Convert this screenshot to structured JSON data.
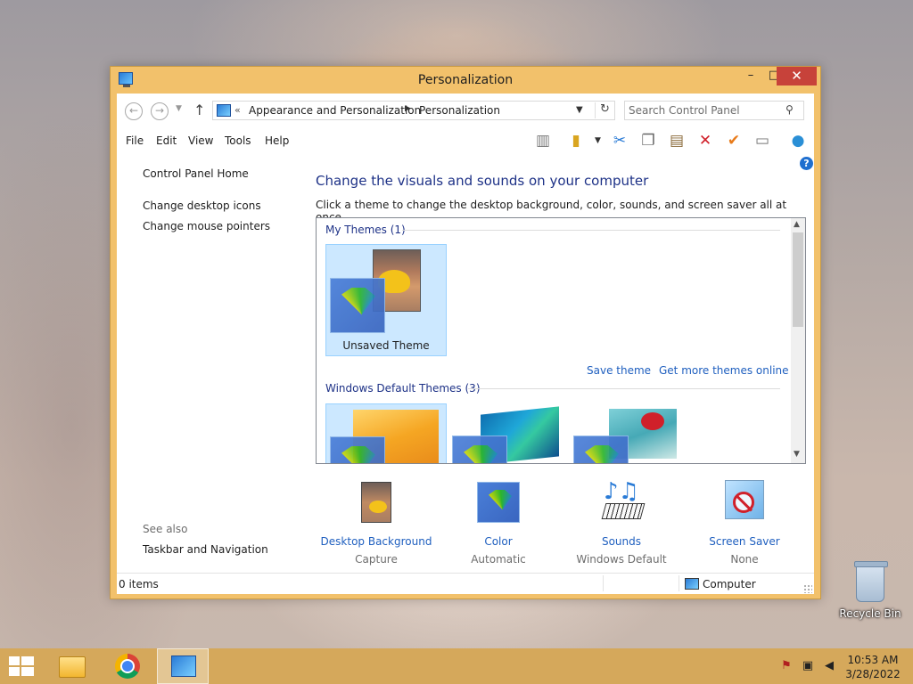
{
  "window": {
    "title": "Personalization",
    "controls": {
      "minimize": "–",
      "maximize": "□",
      "close": "✕"
    }
  },
  "address_bar": {
    "back_symbol": "←",
    "forward_symbol": "→",
    "up_symbol": "↑",
    "overflow": "«",
    "crumbs": [
      "Appearance and Personalization",
      "Personalization"
    ],
    "crumb_separator": "▶",
    "refresh_symbol": "↻"
  },
  "search": {
    "placeholder": "Search Control Panel"
  },
  "menu": [
    "File",
    "Edit",
    "View",
    "Tools",
    "Help"
  ],
  "toolbar_icons": [
    "layout-icon",
    "folder-check-icon",
    "cut-icon",
    "copy-icon",
    "paste-icon",
    "delete-icon",
    "properties-icon",
    "rename-icon",
    "globe-icon"
  ],
  "help": {
    "symbol": "?"
  },
  "left_pane": {
    "home": "Control Panel Home",
    "links": [
      "Change desktop icons",
      "Change mouse pointers"
    ],
    "see_also_label": "See also",
    "see_also_links": [
      "Taskbar and Navigation"
    ]
  },
  "main": {
    "heading": "Change the visuals and sounds on your computer",
    "subheading": "Click a theme to change the desktop background, color, sounds, and screen saver all at once."
  },
  "themes": {
    "my_themes_label": "My Themes (1)",
    "unsaved_theme": "Unsaved Theme",
    "save_theme": "Save theme",
    "get_more": "Get more themes online",
    "default_label": "Windows Default Themes (3)"
  },
  "settings": [
    {
      "link": "Desktop Background",
      "value": "Capture"
    },
    {
      "link": "Color",
      "value": "Automatic"
    },
    {
      "link": "Sounds",
      "value": "Windows Default"
    },
    {
      "link": "Screen Saver",
      "value": "None"
    }
  ],
  "status": {
    "items": "0 items",
    "location": "Computer"
  },
  "desktop": {
    "recycle_bin": "Recycle Bin"
  },
  "taskbar": {
    "time": "10:53 AM",
    "date": "3/28/2022",
    "apps": [
      "file-explorer-icon",
      "chrome-icon",
      "control-panel-icon"
    ]
  },
  "colors": {
    "window_frame": "#f2c16b",
    "close_button": "#c7423a",
    "link_blue": "#1f5fbf",
    "heading_blue": "#1e3287",
    "selection": "#cce8ff"
  }
}
